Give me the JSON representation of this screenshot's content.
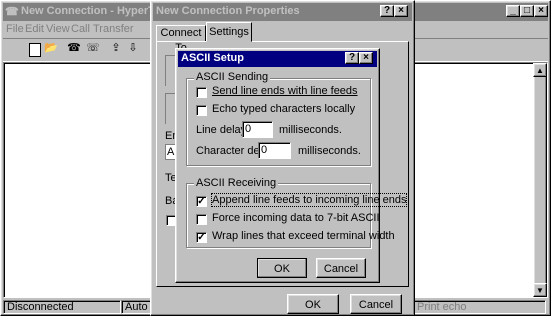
{
  "main_window": {
    "title": "New Connection - HyperTerminal",
    "menu": [
      "File",
      "Edit",
      "View",
      "Call",
      "Transfer"
    ],
    "status": {
      "connection": "Disconnected",
      "detect": "Auto d",
      "print_echo": "Print echo"
    }
  },
  "properties_dialog": {
    "title": "New Connection Properties",
    "tabs": [
      "Connect To",
      "Settings"
    ],
    "partial_labels": [
      "Em",
      "Au",
      "Te",
      "Ba"
    ],
    "ok_label": "OK",
    "cancel_label": "Cancel"
  },
  "ascii_setup": {
    "title": "ASCII Setup",
    "help_glyph": "?",
    "close_glyph": "×",
    "sending_group": "ASCII Sending",
    "send_line_ends": {
      "label": "Send line ends with line feeds",
      "checked": false
    },
    "echo_typed": {
      "label": "Echo typed characters locally",
      "checked": false
    },
    "line_delay": {
      "label": "Line delay:",
      "value": "0",
      "unit": "milliseconds."
    },
    "char_delay": {
      "label": "Character delay:",
      "value": "0",
      "unit": "milliseconds."
    },
    "receiving_group": "ASCII Receiving",
    "append_line_feeds": {
      "label": "Append line feeds to incoming line ends",
      "checked": true
    },
    "force_7bit": {
      "label": "Force incoming data to 7-bit ASCII",
      "checked": false
    },
    "wrap_lines": {
      "label": "Wrap lines that exceed terminal width",
      "checked": true
    },
    "ok_label": "OK",
    "cancel_label": "Cancel",
    "check_mark": "✓"
  },
  "colors": {
    "active_title": "#000080",
    "inactive_title": "#808080",
    "face": "#c0c0c0"
  }
}
